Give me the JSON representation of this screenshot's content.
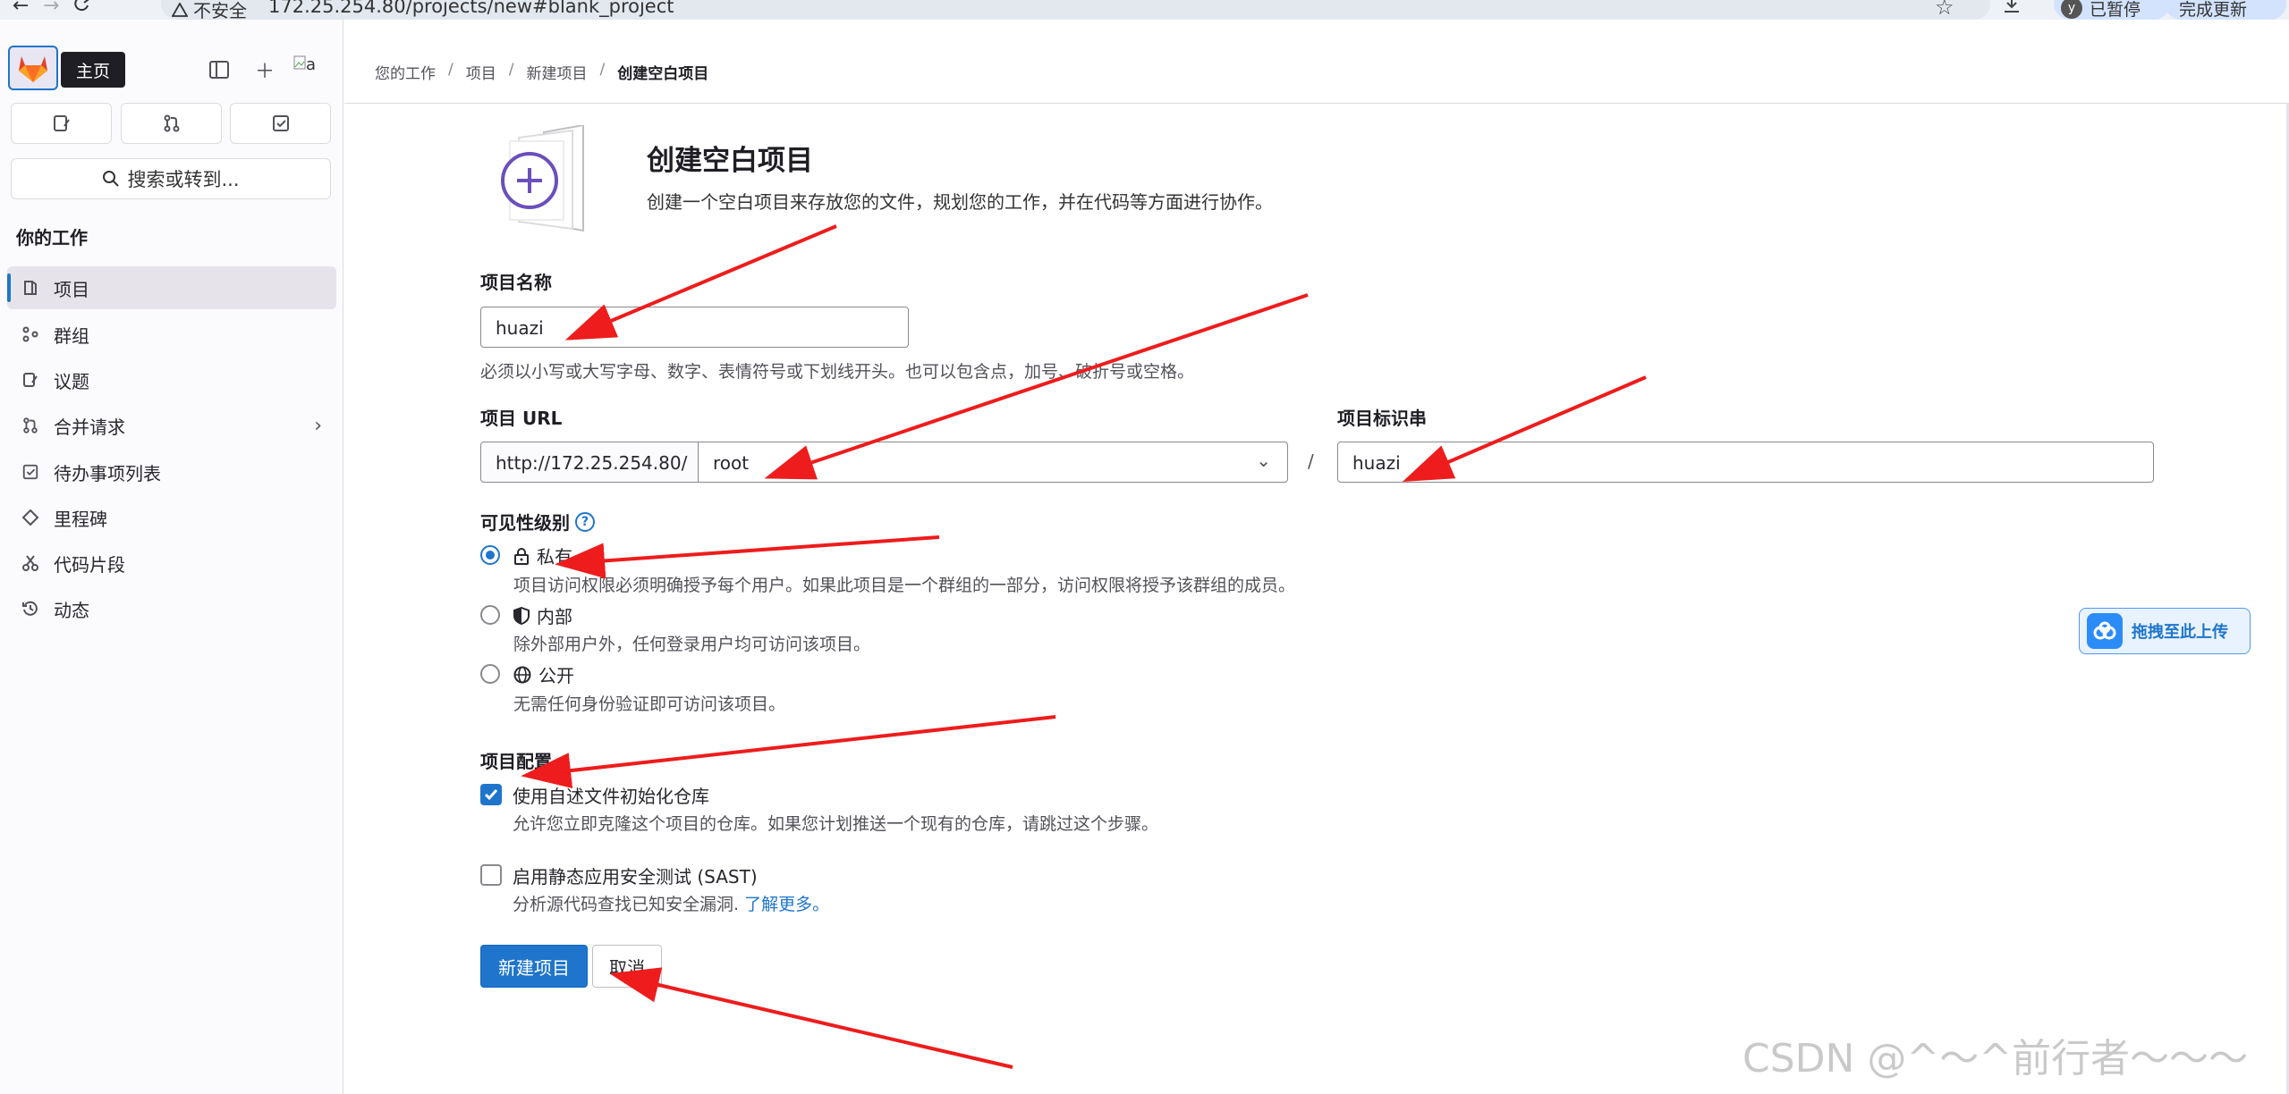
{
  "browser": {
    "back": "←",
    "forward": "→",
    "reload": "C",
    "insecure_label": "不安全",
    "url": "172.25.254.80/projects/new#blank_project",
    "paused_label": "已暂停",
    "profile_initial": "y",
    "update_label": "完成更新"
  },
  "sidebar": {
    "tooltip": "主页",
    "avatar_alt": "a",
    "search_label": "搜索或转到...",
    "section_title": "你的工作",
    "items": [
      {
        "label": "项目",
        "icon": "project-icon",
        "active": true
      },
      {
        "label": "群组",
        "icon": "group-icon"
      },
      {
        "label": "议题",
        "icon": "issues-icon"
      },
      {
        "label": "合并请求",
        "icon": "merge-request-icon",
        "has_chevron": true
      },
      {
        "label": "待办事项列表",
        "icon": "todo-icon"
      },
      {
        "label": "里程碑",
        "icon": "milestone-icon"
      },
      {
        "label": "代码片段",
        "icon": "snippet-icon"
      },
      {
        "label": "动态",
        "icon": "history-icon"
      }
    ]
  },
  "breadcrumb": [
    "您的工作",
    "项目",
    "新建项目",
    "创建空白项目"
  ],
  "page": {
    "title": "创建空白项目",
    "description": "创建一个空白项目来存放您的文件，规划您的工作，并在代码等方面进行协作。"
  },
  "form": {
    "name_label": "项目名称",
    "name_value": "huazi",
    "name_help": "必须以小写或大写字母、数字、表情符号或下划线开头。也可以包含点，加号、破折号或空格。",
    "url_label": "项目 URL",
    "url_prefix": "http://172.25.254.80/",
    "namespace_value": "root",
    "slash": "/",
    "slug_label": "项目标识串",
    "slug_value": "huazi",
    "visibility_label": "可见性级别",
    "visibility_help_glyph": "?",
    "visibility_options": [
      {
        "label": "私有",
        "desc": "项目访问权限必须明确授予每个用户。如果此项目是一个群组的一部分，访问权限将授予该群组的成员。",
        "checked": true,
        "icon": "lock-icon"
      },
      {
        "label": "内部",
        "desc": "除外部用户外，任何登录用户均可访问该项目。",
        "checked": false,
        "icon": "shield-icon"
      },
      {
        "label": "公开",
        "desc": "无需任何身份验证即可访问该项目。",
        "checked": false,
        "icon": "earth-icon"
      }
    ],
    "config_label": "项目配置",
    "config_options": [
      {
        "label": "使用自述文件初始化仓库",
        "desc": "允许您立即克隆这个项目的仓库。如果您计划推送一个现有的仓库，请跳过这个步骤。",
        "checked": true
      },
      {
        "label": "启用静态应用安全测试 (SAST)",
        "desc": "分析源代码查找已知安全漏洞.",
        "link": "了解更多。",
        "checked": false
      }
    ],
    "submit_label": "新建项目",
    "cancel_label": "取消"
  },
  "overlay": {
    "upload_label": "拖拽至此上传",
    "watermark": "CSDN @^～^前行者～～～",
    "arrow_color": "#ee1c1c"
  }
}
